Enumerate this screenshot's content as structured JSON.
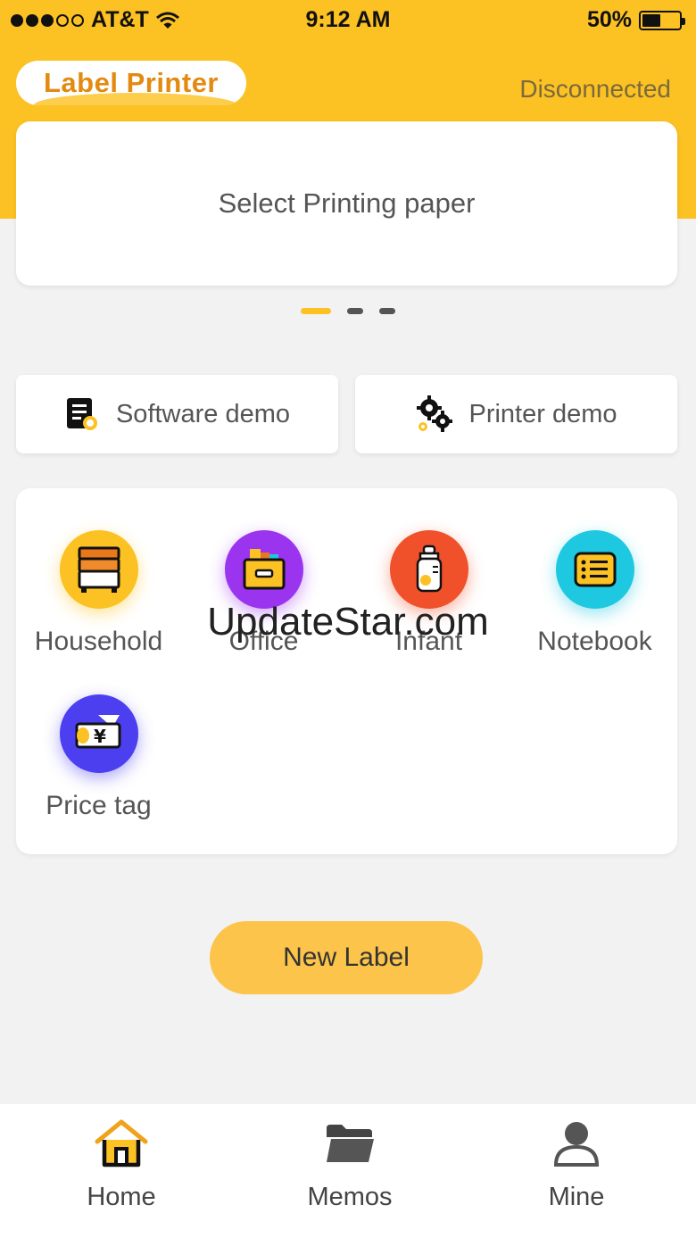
{
  "status_bar": {
    "carrier": "AT&T",
    "time": "9:12 AM",
    "battery": "50%",
    "battery_level": 0.5
  },
  "header": {
    "app_name": "Label Printer",
    "connection_status": "Disconnected"
  },
  "banner": {
    "text": "Select Printing paper",
    "pages": 3,
    "active_page": 1
  },
  "demos": {
    "software_label": "Software demo",
    "printer_label": "Printer demo"
  },
  "categories": [
    {
      "label": "Household",
      "color": "#fcc122",
      "icon": "drawer-cabinet-icon"
    },
    {
      "label": "Office",
      "color": "#9b34ef",
      "icon": "folder-box-icon"
    },
    {
      "label": "Infant",
      "color": "#f0512a",
      "icon": "baby-bottle-icon"
    },
    {
      "label": "Notebook",
      "color": "#1ec8e0",
      "icon": "notebook-icon"
    },
    {
      "label": "Price tag",
      "color": "#4b3ff0",
      "icon": "price-tag-icon"
    }
  ],
  "watermark": "UpdateStar.com",
  "actions": {
    "new_label": "New Label"
  },
  "tabs": [
    {
      "label": "Home",
      "icon": "home-icon",
      "active": true
    },
    {
      "label": "Memos",
      "icon": "folder-icon",
      "active": false
    },
    {
      "label": "Mine",
      "icon": "user-icon",
      "active": false
    }
  ],
  "colors": {
    "accent": "#fcc122",
    "background": "#f2f2f2"
  }
}
